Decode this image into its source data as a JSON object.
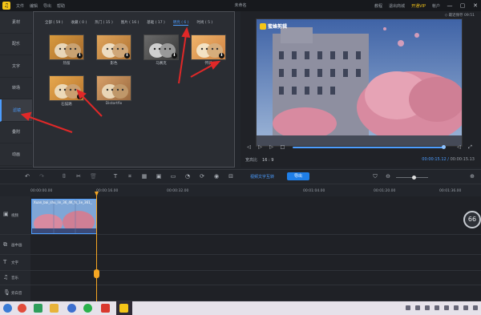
{
  "titlebar": {
    "menu": [
      "文件",
      "编辑",
      "导出",
      "帮助"
    ],
    "title": "未命名",
    "right": [
      "教程",
      "退出商城",
      "开通VIP",
      "帐户"
    ],
    "controls": [
      "—",
      "▢",
      "✕"
    ]
  },
  "sidebar": [
    "素材",
    "配乐",
    "文字",
    "转场",
    "滤镜",
    "叠附",
    "动画"
  ],
  "media": {
    "tabs": [
      "全部 ( 59 )",
      "收藏 ( 0 )",
      "热门 ( 15 )",
      "图片 ( 16 )",
      "基础 ( 17 )",
      "明亮 ( 6 )",
      "时尚 ( 5 )"
    ],
    "thumbs": [
      "热留",
      "影色",
      "马赛克",
      "怀旧",
      "石猫路",
      "Distortfix"
    ]
  },
  "preview": {
    "autosave": "◇ 最近保存 09:51",
    "watermark": "蜜蜂剪辑",
    "ratio_label": "宽高比",
    "ratio_value": "16 : 9",
    "time_current": "00:00:15.12",
    "time_total": "00:00:15.13"
  },
  "toolbar": {
    "text_link": "视频文字互转",
    "export": "导出"
  },
  "ruler": [
    "00:00:00.00",
    "00:00:16.00",
    "00:00:32.00",
    "00:01:04.00",
    "00:01:20.00",
    "00:01:36.00"
  ],
  "tracks": [
    "视频",
    "画中画",
    "文字",
    "音乐",
    "旁白音"
  ],
  "clip_label": "Xuan_bai_shu_lin_36_4K_fs_1e_361_",
  "fps_badge": "66",
  "colors": {
    "accent": "#4c9dff",
    "playhead": "#f5a623",
    "vip": "#f5c518"
  }
}
